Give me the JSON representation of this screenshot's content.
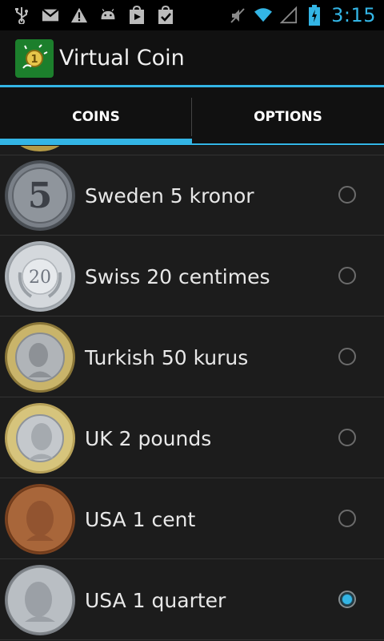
{
  "status_bar": {
    "time": "3:15",
    "icons": [
      "usb-icon",
      "gmail-icon",
      "warning-icon",
      "android-icon",
      "play-store-icon",
      "download-check-icon",
      "mute-icon",
      "wifi-icon",
      "signal-icon",
      "battery-charging-icon"
    ],
    "accent": "#33b5e5"
  },
  "action_bar": {
    "title": "Virtual Coin",
    "icon": "virtual-coin-app-icon"
  },
  "tabs": [
    {
      "label": "COINS",
      "selected": true
    },
    {
      "label": "OPTIONS",
      "selected": false
    }
  ],
  "coins": [
    {
      "label": "Sweden 5 kronor",
      "coin_text": "5",
      "selected": false,
      "icon": "sweden-5-kronor-coin-icon"
    },
    {
      "label": "Swiss 20 centimes",
      "coin_text": "20",
      "selected": false,
      "icon": "swiss-20-centimes-coin-icon"
    },
    {
      "label": "Turkish 50 kurus",
      "coin_text": "",
      "selected": false,
      "icon": "turkish-50-kurus-coin-icon"
    },
    {
      "label": "UK 2 pounds",
      "coin_text": "",
      "selected": false,
      "icon": "uk-2-pounds-coin-icon"
    },
    {
      "label": "USA 1 cent",
      "coin_text": "",
      "selected": false,
      "icon": "usa-1-cent-coin-icon"
    },
    {
      "label": "USA 1 quarter",
      "coin_text": "",
      "selected": true,
      "icon": "usa-1-quarter-coin-icon"
    }
  ]
}
